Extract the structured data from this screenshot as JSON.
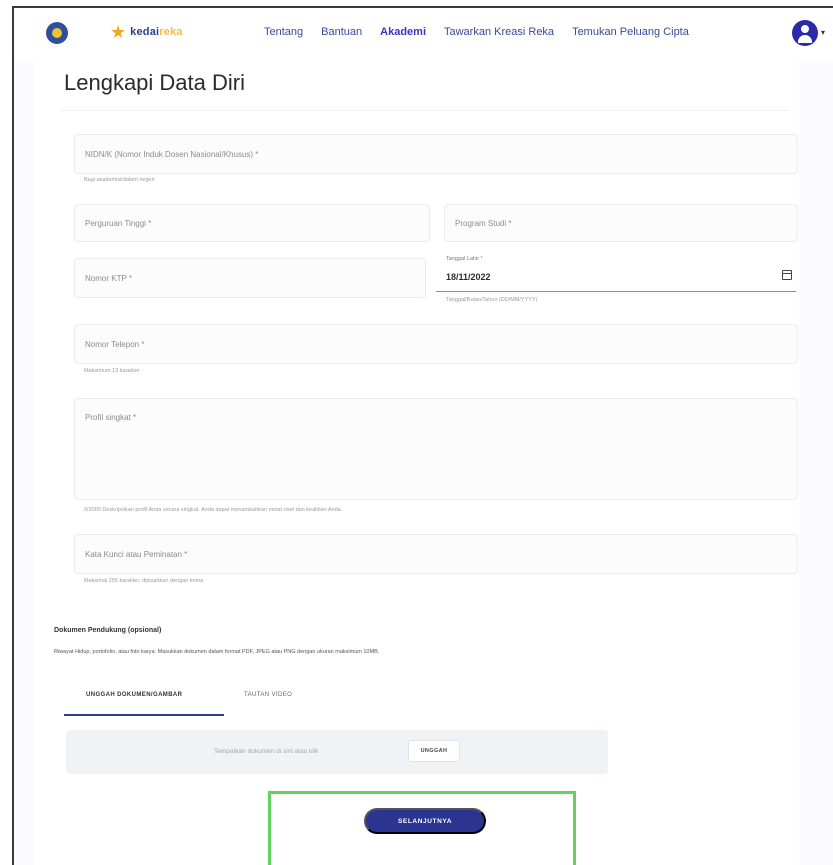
{
  "nav": {
    "brand_left": "kedai",
    "brand_right": "reka",
    "links": [
      "Tentang",
      "Bantuan",
      "Akademi",
      "Tawarkan Kreasi Reka",
      "Temukan Peluang Cipta"
    ],
    "active_link": "Akademi",
    "caret": "▾"
  },
  "form": {
    "title": "Lengkapi Data Diri",
    "nidn_placeholder": "NIDN/K (Nomor Induk Dosen Nasional/Khusus) *",
    "nidn_helper": "Bagi akademisi/dalam negeri",
    "university_placeholder": "Perguruan Tinggi *",
    "program_placeholder": "Program Studi *",
    "ktp_placeholder": "Nomor KTP *",
    "birthdate_label": "Tanggal Lahir *",
    "birthdate_value": "18/11/2022",
    "birthdate_helper": "Tanggal/Bulan/Tahun (DD/MM/YYYY)",
    "phone_placeholder": "Nomor Telepon *",
    "phone_helper": "Maksimum 13 karakter",
    "profile_placeholder": "Profil singkat *",
    "profile_helper": "0/2000 Deskripsikan profil Anda secara singkat. Anda dapat menambahkan minat riset dan keahlian Anda.",
    "keywords_placeholder": "Kata Kunci atau Peminatan *",
    "keywords_helper": "Maksimal 255 karakter, dipisahkan dengan koma"
  },
  "docs": {
    "title": "Dokumen Pendukung (opsional)",
    "description": "Riwayat Hidup, portofolio, atau foto karya. Masukkan dokumen dalam format PDF, JPEG atau PNG dengan ukuran maksimum 10MB.",
    "tab_upload": "UNGGAH DOKUMEN/GAMBAR",
    "tab_video": "TAUTAN VIDEO",
    "upload_hint": "Tempatkan dokumen di sini atau klik",
    "upload_button": "UNGGAH"
  },
  "actions": {
    "next_button": "SELANJUTNYA"
  },
  "colors": {
    "primary": "#2c3491",
    "accent": "#f0a81e",
    "highlight": "#5fd35b"
  }
}
